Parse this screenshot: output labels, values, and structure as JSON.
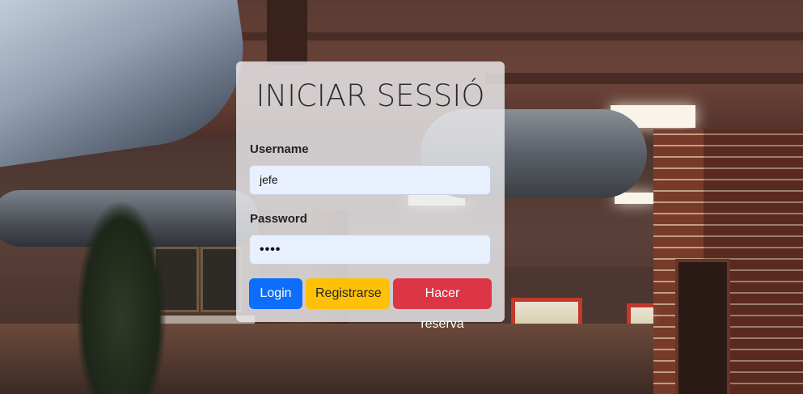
{
  "login": {
    "title": "INICIAR SESSIÓ",
    "username_label": "Username",
    "username_value": "jefe",
    "password_label": "Password",
    "password_value": "••••",
    "buttons": {
      "login": "Login",
      "register": "Registrarse",
      "reserve": "Hacer reserva"
    }
  },
  "colors": {
    "login_button": "#0d6efd",
    "register_button": "#ffc107",
    "reserve_button": "#dc3545"
  }
}
